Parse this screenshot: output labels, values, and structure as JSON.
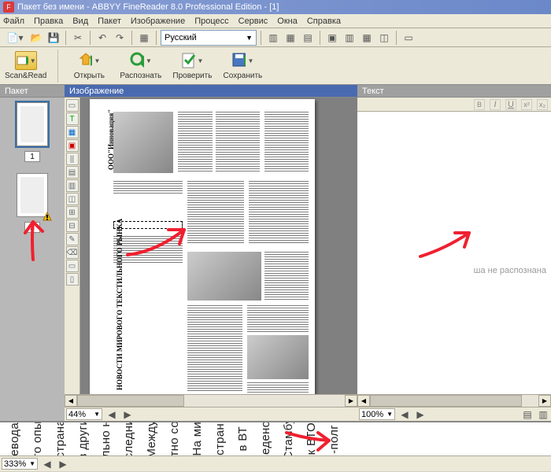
{
  "title_text": "Пакет без имени - ABBYY FineReader 8.0 Professional Edition - [1]",
  "menus": [
    "Файл",
    "Правка",
    "Вид",
    "Пакет",
    "Изображение",
    "Процесс",
    "Сервис",
    "Окна",
    "Справка"
  ],
  "language": "Русский",
  "big_buttons": {
    "scan_read": "Scan&Read",
    "open": "Открыть",
    "recognize": "Распознать",
    "check": "Проверить",
    "save": "Сохранить"
  },
  "panels": {
    "batch": "Пакет",
    "image": "Изображение",
    "text": "Текст"
  },
  "thumbs": {
    "page1_num": "1",
    "page2_num": "2"
  },
  "image_zoom": "44%",
  "text_zoom": "100%",
  "zoom_status": "333%",
  "text_message": "ша не распознана",
  "page_title_1": "ООО\"Инновация\"",
  "page_title_2": "НОВОСТИ МИРОВОГО ТЕКСТИЛЬНОГО РЫНКА",
  "zoom_text_fragments": [
    "евода",
    "го опы",
    "страна",
    "в други",
    "льно н",
    "следни",
    "Между",
    "тно со",
    "На ми",
    "стран",
    "в ВТ",
    "введено в",
    "Стамбу",
    "к ВТО",
    "-полг"
  ]
}
